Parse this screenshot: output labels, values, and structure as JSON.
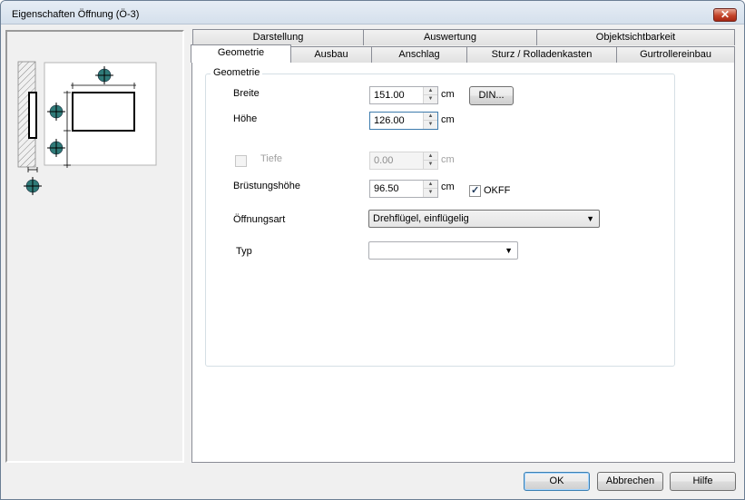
{
  "window": {
    "title": "Eigenschaften Öffnung (Ö-3)",
    "close_glyph": "✕"
  },
  "tabs": {
    "row1": [
      "Darstellung",
      "Auswertung",
      "Objektsichtbarkeit"
    ],
    "row2": [
      "Geometrie",
      "Ausbau",
      "Anschlag",
      "Sturz / Rolladenkasten",
      "Gurtrollereinbau"
    ],
    "active": "Geometrie"
  },
  "group": {
    "title": "Geometrie"
  },
  "fields": {
    "breite": {
      "label": "Breite",
      "value": "151.00",
      "unit": "cm"
    },
    "hoehe": {
      "label": "Höhe",
      "value": "126.00",
      "unit": "cm"
    },
    "tiefe": {
      "label": "Tiefe",
      "value": "0.00",
      "unit": "cm",
      "enabled": false,
      "checked": false
    },
    "bruestung": {
      "label": "Brüstungshöhe",
      "value": "96.50",
      "unit": "cm"
    },
    "okff": {
      "label": "OKFF",
      "checked": true
    },
    "oeffnungsart": {
      "label": "Öffnungsart",
      "value": "Drehflügel, einflügelig"
    },
    "typ": {
      "label": "Typ",
      "value": ""
    }
  },
  "buttons": {
    "din": "DIN...",
    "ok": "OK",
    "abbrechen": "Abbrechen",
    "hilfe": "Hilfe"
  },
  "icons": {
    "spin_up": "▲",
    "spin_down": "▼",
    "dropdown": "▼",
    "check": "✓"
  },
  "colors": {
    "crosshair": "#2f7a78",
    "wall_hatch": "#8a8a8a"
  }
}
